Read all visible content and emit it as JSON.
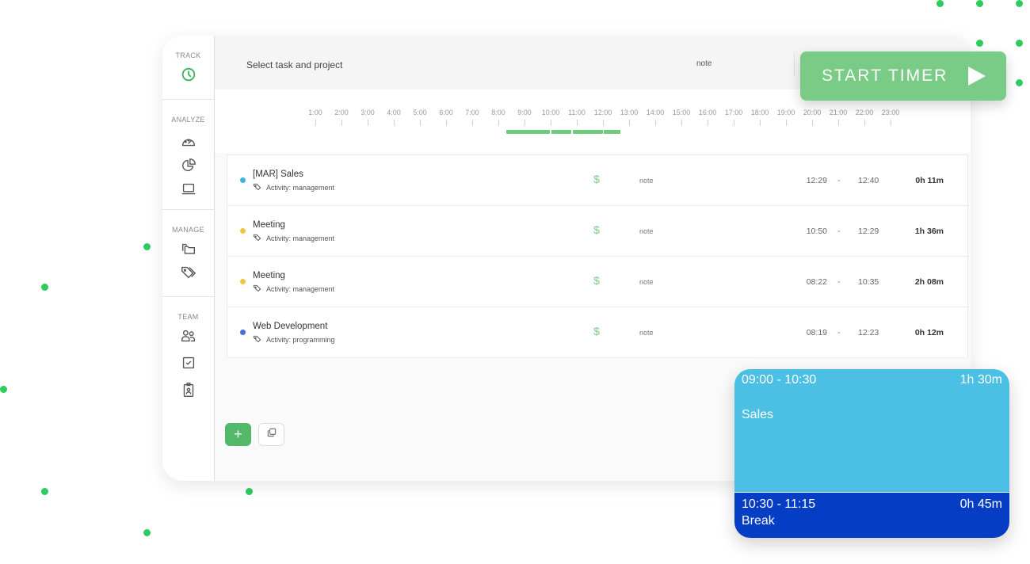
{
  "sidebar": {
    "sections": [
      {
        "label": "TRACK",
        "icons": [
          "clock-icon"
        ]
      },
      {
        "label": "ANALYZE",
        "icons": [
          "dashboard-gauge-icon",
          "pie-chart-icon",
          "laptop-icon"
        ]
      },
      {
        "label": "MANAGE",
        "icons": [
          "folders-icon",
          "tags-icon"
        ]
      },
      {
        "label": "TEAM",
        "icons": [
          "users-icon",
          "checkbox-icon",
          "badge-icon"
        ]
      }
    ]
  },
  "topbar": {
    "task_placeholder": "Select task and project",
    "note_placeholder": "note"
  },
  "timeline": {
    "hours": [
      "1:00",
      "2:00",
      "3:00",
      "4:00",
      "5:00",
      "6:00",
      "7:00",
      "8:00",
      "9:00",
      "10:00",
      "11:00",
      "12:00",
      "13:00",
      "14:00",
      "15:00",
      "16:00",
      "17:00",
      "18:00",
      "19:00",
      "20:00",
      "21:00",
      "22:00",
      "23:00"
    ],
    "segments": [
      {
        "start": "08:19",
        "end": "09:59"
      },
      {
        "start": "10:02",
        "end": "10:47"
      },
      {
        "start": "10:50",
        "end": "12:00"
      },
      {
        "start": "12:02",
        "end": "12:40"
      }
    ],
    "bar_color": "#6fca7d"
  },
  "entries": [
    {
      "title": "[MAR] Sales",
      "activity": "Activity: management",
      "color": "#3db3e3",
      "billable_icon": "$",
      "note": "note",
      "start": "12:29",
      "separator": "-",
      "end": "12:40",
      "duration": "0h 11m"
    },
    {
      "title": "Meeting",
      "activity": "Activity: management",
      "color": "#f5c445",
      "billable_icon": "$",
      "note": "note",
      "start": "10:50",
      "separator": "-",
      "end": "12:29",
      "duration": "1h 36m"
    },
    {
      "title": "Meeting",
      "activity": "Activity: management",
      "color": "#f5c445",
      "billable_icon": "$",
      "note": "note",
      "start": "08:22",
      "separator": "-",
      "end": "10:35",
      "duration": "2h 08m"
    },
    {
      "title": "Web Development",
      "activity": "Activity: programming",
      "color": "#4a6fd8",
      "billable_icon": "$",
      "note": "note",
      "start": "08:19",
      "separator": "-",
      "end": "12:23",
      "duration": "0h 12m"
    }
  ],
  "actions": {
    "add_label": "+",
    "copy_icon": "copy-icon"
  },
  "start_timer": {
    "label": "START TIMER",
    "color": "#7acb86"
  },
  "calendar": {
    "blocks": [
      {
        "time": "09:00 - 10:30",
        "duration": "1h 30m",
        "title": "Sales",
        "color": "#4cc0e4"
      },
      {
        "time": "10:30 - 11:15",
        "duration": "0h 45m",
        "title": "Break",
        "color": "#053dc4"
      }
    ]
  }
}
